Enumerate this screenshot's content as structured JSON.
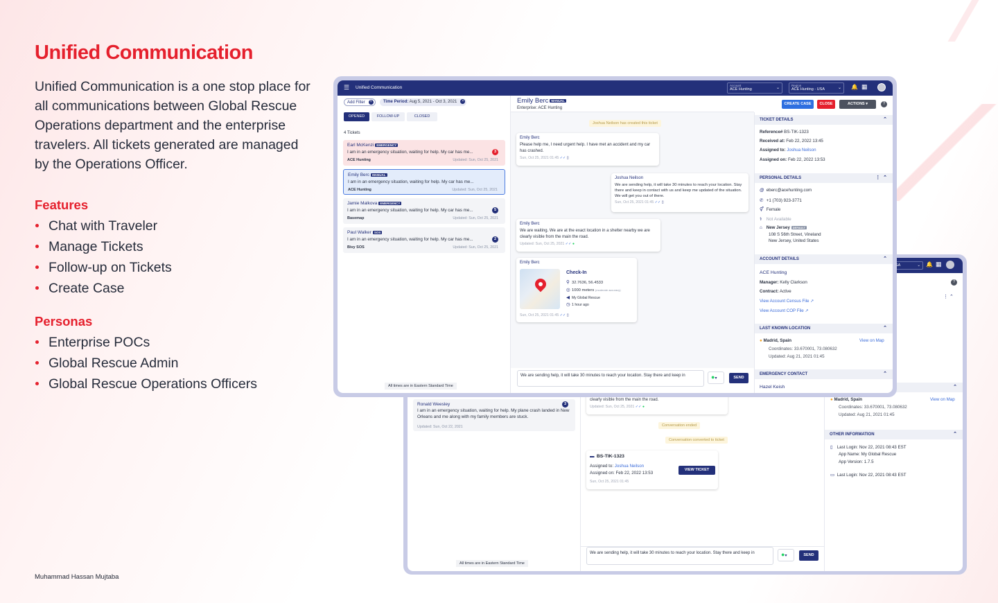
{
  "slide": {
    "title": "Unified Communication",
    "description": "Unified Communication is a one stop place for all communications between Global Rescue Operations department and the enterprise travelers. All tickets generated are managed by the Operations Officer.",
    "features_title": "Features",
    "features": [
      "Chat with Traveler",
      "Manage Tickets",
      "Follow-up on Tickets",
      "Create Case"
    ],
    "personas_title": "Personas",
    "personas": [
      "Enterprise POCs",
      "Global Rescue Admin",
      "Global Rescue Operations Officers"
    ],
    "author": "Muhammad Hassan Mujtaba"
  },
  "app": {
    "title": "Unified Communication",
    "account_label": "Account",
    "account_value": "ACE Hunting",
    "region_label": "Region",
    "region_value": "ACE Hunting - USA",
    "add_filter": "Add Filter",
    "time_period_label": "Time Period:",
    "time_period_value": "Aug 5, 2021 - Oct 3, 2021",
    "tabs": [
      "OPENED",
      "FOLLOW-UP",
      "CLOSED"
    ],
    "ticket_count": "4 Tickets",
    "tickets": [
      {
        "name": "Earl McKenzi",
        "tag": "EMERGENCY",
        "msg": "I am in an emergency situation, waiting for help. My car has me...",
        "ent": "ACE Hunting",
        "upd": "Updated: Sun, Oct 25, 2021",
        "count": "3"
      },
      {
        "name": "Emily Berc",
        "tag": "MANUAL",
        "msg": "I am in an emergency situation, waiting for help. My car has me...",
        "ent": "ACE Hunting",
        "upd": "Updated: Sun, Oct 25, 2021",
        "count": ""
      },
      {
        "name": "Jamie Malkova",
        "tag": "EMERGENCY",
        "msg": "I am in an emergency situation, waiting for help. My car has me...",
        "ent": "Basemap",
        "upd": "Updated: Sun, Oct 25, 2021",
        "count": "5"
      },
      {
        "name": "Paul Walker",
        "tag": "SOS",
        "msg": "I am in an emergency situation, waiting for help. My car has me...",
        "ent": "Bivy SOS",
        "upd": "Updated: Sun, Oct 25, 2021",
        "count": "2"
      }
    ],
    "timezone_note": "All times are in Eastern Standard Time",
    "chat": {
      "name": "Emily Berc",
      "tag": "MANUAL",
      "enterprise": "Enterprise: ACE Hunting",
      "create_case": "CREATE CASE",
      "close": "CLOSE",
      "actions": "ACTIONS",
      "sys_created": "Joshua Neilson has created this ticket",
      "msg1_sender": "Emily Berc",
      "msg1_text": "Please help me, I need urgent help. I have met an accident and my car has crashed.",
      "msg1_date": "Sun, Oct 25, 2021 01:45",
      "msg2_sender": "Joshua Neilson",
      "msg2_text": "We are sending help, it will take 30 minutes to reach your location. Stay there and keep in contact with us and keep me updated of the situation. We will get you out of there.",
      "msg2_date": "Sun, Oct 25, 2021 01:45",
      "msg3_sender": "Emily Berc",
      "msg3_text": "We are waiting. We are at the exact location in a shelter nearby we are clearly visible from the main the road.",
      "msg3_date": "Updated: Sun, Oct 25, 2021",
      "msg4_sender": "Emily Berc",
      "checkin_title": "Check-In",
      "checkin_coords": "32.7636, 56.4533",
      "checkin_dist": "1000 meters",
      "checkin_acc": "(moderate accuracy)",
      "checkin_app": "My Global Rescue",
      "checkin_time": "1 hour ago",
      "msg4_date": "Sun, Oct 25, 2021 01:45",
      "input_text": "We are sending help, it will take 30 minutes to reach your location. Stay there and keep in",
      "send": "SEND"
    },
    "details": {
      "ticket_title": "TICKET DETAILS",
      "ref_label": "Reference#",
      "ref_value": "BS-TIK-1323",
      "received_label": "Received at:",
      "received_value": "Feb 22, 2022 13:45",
      "assigned_label": "Assigned to:",
      "assigned_value": "Joshua Neilson",
      "assigned_on_label": "Assigned on:",
      "assigned_on_value": "Feb 22, 2022 13:53",
      "personal_title": "PERSONAL DETAILS",
      "email": "eberc@acehunting.com",
      "phone": "+1 (703) 923-3771",
      "gender": "Female",
      "na": "Not Available",
      "location_name": "New Jersey",
      "location_tag": "DEFAULT",
      "address1": "108 S 56th Street, Vineland",
      "address2": "New Jersey, United States",
      "account_title": "ACCOUNT DETAILS",
      "account_name": "ACE Hunting",
      "manager_label": "Manager:",
      "manager_value": "Kelly Clarkson",
      "contract_label": "Contract:",
      "contract_value": "Active",
      "census_link": "View Account Census File",
      "cop_link": "View Account COP File",
      "lastloc_title": "LAST KNOWN LOCATION",
      "lastloc_city": "Madrid, Spain",
      "view_map": "View on Map",
      "coords": "Coordinates: 33.670001, 73.080632",
      "updated": "Updated:  Aug 21, 2021 01:45",
      "emergency_title": "EMERGENCY CONTACT",
      "emergency_name": "Hazel Keish"
    }
  },
  "back": {
    "region_partial": "SA",
    "ticket": {
      "name": "Ronald Weesley",
      "count": "3",
      "msg": "I am in an emergency situation, waiting for help. My plane crash landed in New Orleans and me along with my family members are stuck.",
      "upd": "Updated: Sun, Oct 22, 2021"
    },
    "msg_text": "We are waiting. We are at the exact location in a shelter nearby we are clearly visible from the main the road.",
    "msg_date": "Updated: Sun, Oct 25, 2021",
    "sys1": "Conversation ended",
    "sys2": "Conversation converted to ticket",
    "ticket_card": {
      "ref": "BS-TIK-1323",
      "assigned_label": "Assigned to:",
      "assigned_value": "Joshua Neilson",
      "assigned_on": "Assigned on: Feb 22, 2022 13:53",
      "date": "Sun, Oct 25, 2021 01:45",
      "view": "VIEW TICKET"
    },
    "input_text": "We are sending help, it will take 30 minutes to reach your location. Stay there and keep in",
    "send": "SEND",
    "timezone_note": "All times are in Eastern Standard Time",
    "lastloc_city": "Madrid, Spain",
    "view_map": "View on Map",
    "coords": "Coordinates: 33.670001, 73.080632",
    "updated": "Updated:  Aug 21, 2021 01:45",
    "other_title": "OTHER INFORMATION",
    "last_login": "Last Login: Nov 22, 2021 08:43 EST",
    "app_name": "App Name: My Global Rescue",
    "app_version": "App Version: 1.7.5",
    "last_login2": "Last Login: Nov 22, 2021 08:43 EST",
    "partial1": "nd",
    "partial2": "s"
  },
  "colors": {
    "accent": "#e5202d",
    "navy": "#23307a",
    "link": "#3a6bd9",
    "emergency": "#e5202d",
    "whatsapp": "#25d366"
  }
}
